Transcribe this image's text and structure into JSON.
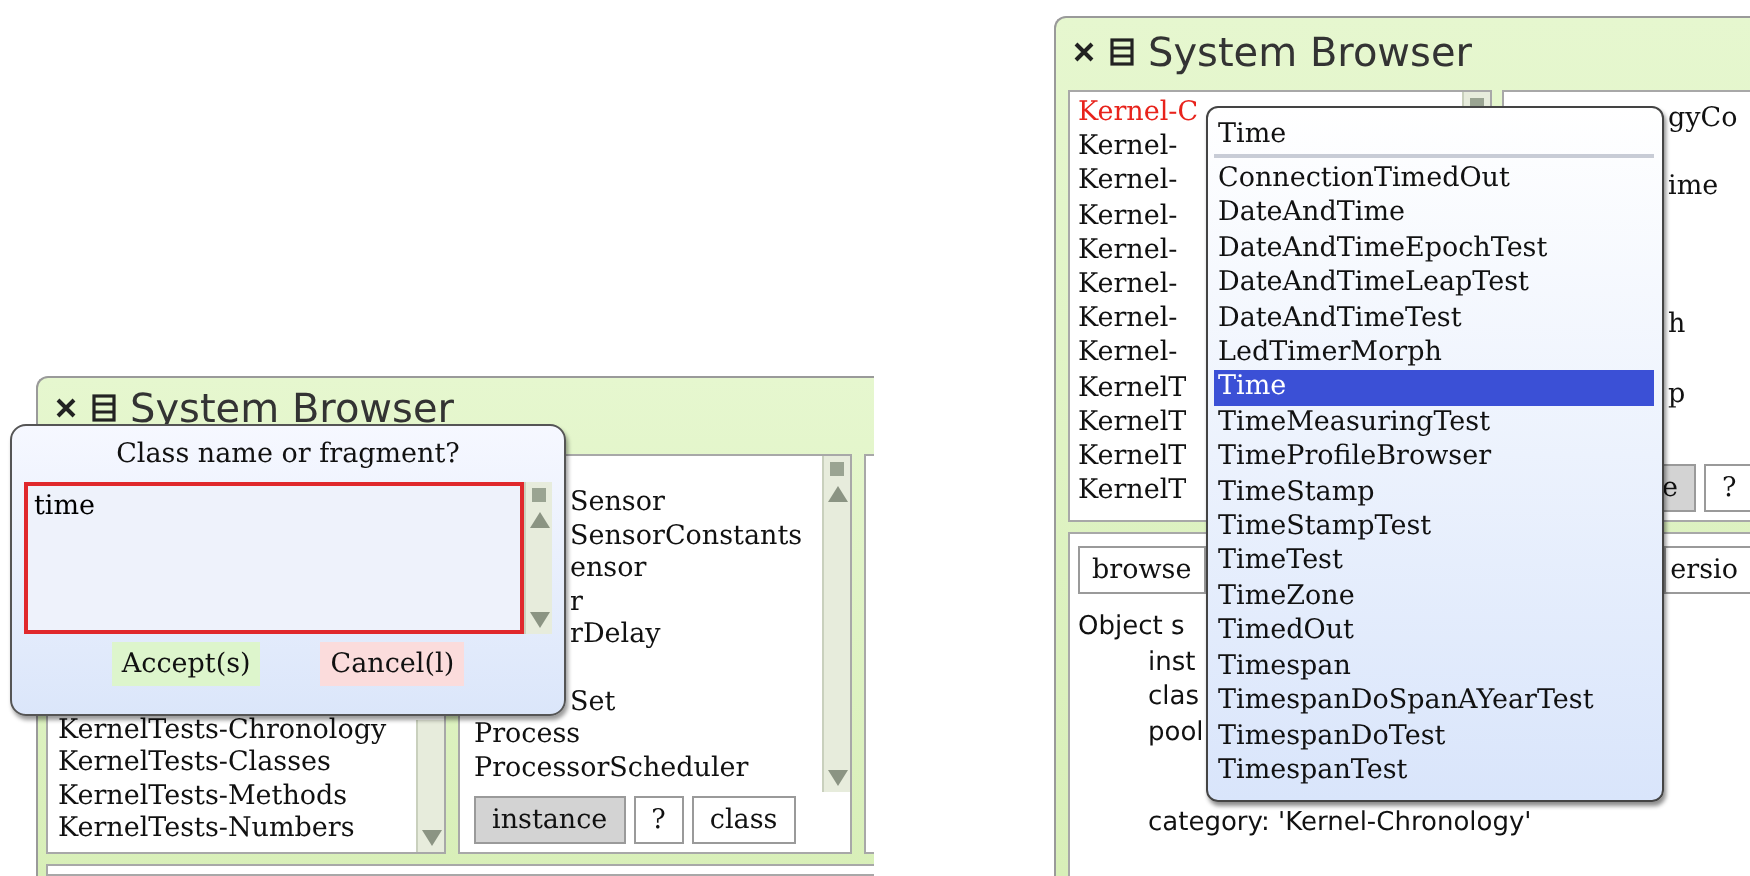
{
  "left_window": {
    "title": "System Browser",
    "package_list": {
      "items": [
        "KernelTests-Chronology",
        "KernelTests-Classes",
        "KernelTests-Methods",
        "KernelTests-Numbers"
      ]
    },
    "class_list": {
      "items": [
        "Sensor",
        "SensorConstants",
        "ensor",
        "r",
        "rDelay",
        "Set",
        "Process",
        "ProcessorScheduler"
      ]
    },
    "class_side_buttons": [
      {
        "label": "instance",
        "selected": true
      },
      {
        "label": "?",
        "selected": false
      },
      {
        "label": "class",
        "selected": false
      }
    ]
  },
  "dialog": {
    "prompt": "Class name or fragment?",
    "value": "time",
    "buttons": [
      {
        "label": "Accept(s)",
        "kind": "accept"
      },
      {
        "label": "Cancel(l)",
        "kind": "cancel"
      }
    ]
  },
  "right_window": {
    "title": "System Browser",
    "package_list": {
      "items": [
        {
          "label": "Kernel-C",
          "selected": true
        },
        {
          "label": "Kernel-",
          "selected": false
        },
        {
          "label": "Kernel-",
          "selected": false
        },
        {
          "label": "Kernel-",
          "selected": false
        },
        {
          "label": "Kernel-",
          "selected": false
        },
        {
          "label": "Kernel-",
          "selected": false
        },
        {
          "label": "Kernel-",
          "selected": false
        },
        {
          "label": "Kernel-",
          "selected": false
        },
        {
          "label": "KernelT",
          "selected": false
        },
        {
          "label": "KernelT",
          "selected": false
        },
        {
          "label": "KernelT",
          "selected": false
        },
        {
          "label": "KernelT",
          "selected": false
        }
      ]
    },
    "class_list": {
      "items": [
        "gyCo",
        "ime",
        "h",
        "p"
      ]
    },
    "class_side_buttons": [
      {
        "label": "e",
        "selected": true
      },
      {
        "label": "?",
        "selected": false
      }
    ],
    "toolbar": [
      "browse",
      "ersio"
    ],
    "code": [
      "Object s",
      "inst",
      "clas",
      "pool",
      "category: 'Kernel-Chronology'"
    ]
  },
  "popup": {
    "title": "Time",
    "items": [
      {
        "label": "ConnectionTimedOut",
        "selected": false
      },
      {
        "label": "DateAndTime",
        "selected": false
      },
      {
        "label": "DateAndTimeEpochTest",
        "selected": false
      },
      {
        "label": "DateAndTimeLeapTest",
        "selected": false
      },
      {
        "label": "DateAndTimeTest",
        "selected": false
      },
      {
        "label": "LedTimerMorph",
        "selected": false
      },
      {
        "label": "Time",
        "selected": true
      },
      {
        "label": "TimeMeasuringTest",
        "selected": false
      },
      {
        "label": "TimeProfileBrowser",
        "selected": false
      },
      {
        "label": "TimeStamp",
        "selected": false
      },
      {
        "label": "TimeStampTest",
        "selected": false
      },
      {
        "label": "TimeTest",
        "selected": false
      },
      {
        "label": "TimeZone",
        "selected": false
      },
      {
        "label": "TimedOut",
        "selected": false
      },
      {
        "label": "Timespan",
        "selected": false
      },
      {
        "label": "TimespanDoSpanAYearTest",
        "selected": false
      },
      {
        "label": "TimespanDoTest",
        "selected": false
      },
      {
        "label": "TimespanTest",
        "selected": false
      }
    ]
  }
}
